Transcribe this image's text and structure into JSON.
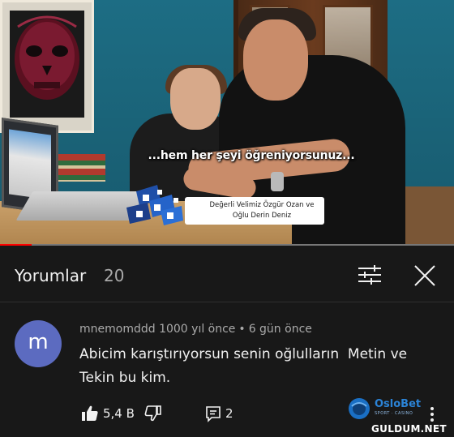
{
  "video": {
    "subtitle": "...hem her şeyi öğreniyorsunuz...",
    "lower_third": {
      "line1": "Değerli Velimiz Özgür Ozan ve",
      "line2": "Oğlu Derin Deniz"
    },
    "progress": 0.07,
    "accent_color": "#ff0000"
  },
  "comments_panel": {
    "title": "Yorumlar",
    "count": "20",
    "filter_icon": "sliders-icon",
    "close_icon": "close-icon"
  },
  "comment": {
    "avatar_letter": "m",
    "avatar_color": "#5c6bc0",
    "author": "mnemomddd 1000 yıl önce",
    "separator": "•",
    "time": "6 gün önce",
    "text": "Abicim karıştırıyorsun senin oğlulların  Metin ve Tekin bu kim.",
    "like_count": "5,4 B",
    "reply_count": "2"
  },
  "overlay": {
    "brand_name": "OsloBet",
    "brand_tagline": "SPORT · CASINO",
    "watermark": "GULDUM.NET"
  }
}
